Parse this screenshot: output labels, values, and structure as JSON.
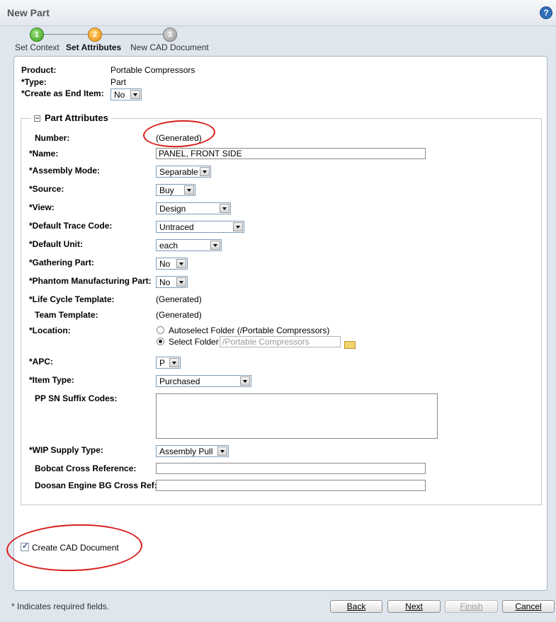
{
  "window": {
    "title": "New Part",
    "help_icon": "?"
  },
  "steps": [
    {
      "number": "1",
      "label": "Set Context",
      "state": "complete"
    },
    {
      "number": "2",
      "label": "Set Attributes",
      "state": "active"
    },
    {
      "number": "3",
      "label": "New CAD Document",
      "state": "pending"
    }
  ],
  "context": {
    "product_label": "Product:",
    "product_value": "Portable Compressors",
    "type_label": "Type:",
    "type_value": "Part",
    "end_item_label": "Create as End Item:",
    "end_item_value": "No"
  },
  "required_marker": "*",
  "part_attributes": {
    "legend": "Part Attributes",
    "number_label": "Number:",
    "number_value": "(Generated)",
    "name_label": "Name:",
    "name_value": "PANEL, FRONT SIDE",
    "assembly_mode_label": "Assembly Mode:",
    "assembly_mode_value": "Separable",
    "source_label": "Source:",
    "source_value": "Buy",
    "view_label": "View:",
    "view_value": "Design",
    "trace_code_label": "Default Trace Code:",
    "trace_code_value": "Untraced",
    "unit_label": "Default Unit:",
    "unit_value": "each",
    "gathering_label": "Gathering Part:",
    "gathering_value": "No",
    "phantom_label": "Phantom Manufacturing Part:",
    "phantom_value": "No",
    "lifecycle_label": "Life Cycle Template:",
    "lifecycle_value": "(Generated)",
    "team_label": "Team Template:",
    "team_value": "(Generated)",
    "location_label": "Location:",
    "location_autoselect": "Autoselect Folder (/Portable Compressors)",
    "location_select": "Select Folder",
    "location_folder_value": "/Portable Compressors",
    "apc_label": "APC:",
    "apc_value": "P",
    "item_type_label": "Item Type:",
    "item_type_value": "Purchased",
    "pp_sn_label": "PP SN Suffix Codes:",
    "pp_sn_value": "",
    "wip_label": "WIP Supply Type:",
    "wip_value": "Assembly Pull",
    "bobcat_label": "Bobcat Cross Reference:",
    "bobcat_value": "",
    "doosan_label": "Doosan Engine BG Cross Ref:",
    "doosan_value": ""
  },
  "create_cad_label": "Create CAD Document",
  "create_cad_checked": true,
  "footer": {
    "required_note": "* Indicates required fields.",
    "back": "Back",
    "next": "Next",
    "finish": "Finish",
    "cancel": "Cancel"
  },
  "annotation_color": "#d81c1c"
}
